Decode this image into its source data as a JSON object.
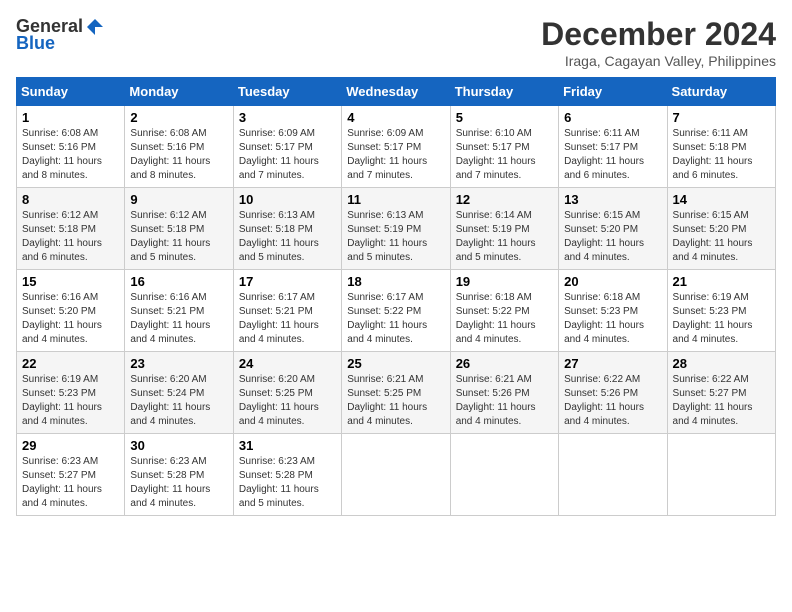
{
  "logo": {
    "general": "General",
    "blue": "Blue"
  },
  "title": "December 2024",
  "location": "Iraga, Cagayan Valley, Philippines",
  "days_header": [
    "Sunday",
    "Monday",
    "Tuesday",
    "Wednesday",
    "Thursday",
    "Friday",
    "Saturday"
  ],
  "weeks": [
    [
      {
        "day": "1",
        "sunrise": "6:08 AM",
        "sunset": "5:16 PM",
        "daylight": "11 hours and 8 minutes."
      },
      {
        "day": "2",
        "sunrise": "6:08 AM",
        "sunset": "5:16 PM",
        "daylight": "11 hours and 8 minutes."
      },
      {
        "day": "3",
        "sunrise": "6:09 AM",
        "sunset": "5:17 PM",
        "daylight": "11 hours and 7 minutes."
      },
      {
        "day": "4",
        "sunrise": "6:09 AM",
        "sunset": "5:17 PM",
        "daylight": "11 hours and 7 minutes."
      },
      {
        "day": "5",
        "sunrise": "6:10 AM",
        "sunset": "5:17 PM",
        "daylight": "11 hours and 7 minutes."
      },
      {
        "day": "6",
        "sunrise": "6:11 AM",
        "sunset": "5:17 PM",
        "daylight": "11 hours and 6 minutes."
      },
      {
        "day": "7",
        "sunrise": "6:11 AM",
        "sunset": "5:18 PM",
        "daylight": "11 hours and 6 minutes."
      }
    ],
    [
      {
        "day": "8",
        "sunrise": "6:12 AM",
        "sunset": "5:18 PM",
        "daylight": "11 hours and 6 minutes."
      },
      {
        "day": "9",
        "sunrise": "6:12 AM",
        "sunset": "5:18 PM",
        "daylight": "11 hours and 5 minutes."
      },
      {
        "day": "10",
        "sunrise": "6:13 AM",
        "sunset": "5:18 PM",
        "daylight": "11 hours and 5 minutes."
      },
      {
        "day": "11",
        "sunrise": "6:13 AM",
        "sunset": "5:19 PM",
        "daylight": "11 hours and 5 minutes."
      },
      {
        "day": "12",
        "sunrise": "6:14 AM",
        "sunset": "5:19 PM",
        "daylight": "11 hours and 5 minutes."
      },
      {
        "day": "13",
        "sunrise": "6:15 AM",
        "sunset": "5:20 PM",
        "daylight": "11 hours and 4 minutes."
      },
      {
        "day": "14",
        "sunrise": "6:15 AM",
        "sunset": "5:20 PM",
        "daylight": "11 hours and 4 minutes."
      }
    ],
    [
      {
        "day": "15",
        "sunrise": "6:16 AM",
        "sunset": "5:20 PM",
        "daylight": "11 hours and 4 minutes."
      },
      {
        "day": "16",
        "sunrise": "6:16 AM",
        "sunset": "5:21 PM",
        "daylight": "11 hours and 4 minutes."
      },
      {
        "day": "17",
        "sunrise": "6:17 AM",
        "sunset": "5:21 PM",
        "daylight": "11 hours and 4 minutes."
      },
      {
        "day": "18",
        "sunrise": "6:17 AM",
        "sunset": "5:22 PM",
        "daylight": "11 hours and 4 minutes."
      },
      {
        "day": "19",
        "sunrise": "6:18 AM",
        "sunset": "5:22 PM",
        "daylight": "11 hours and 4 minutes."
      },
      {
        "day": "20",
        "sunrise": "6:18 AM",
        "sunset": "5:23 PM",
        "daylight": "11 hours and 4 minutes."
      },
      {
        "day": "21",
        "sunrise": "6:19 AM",
        "sunset": "5:23 PM",
        "daylight": "11 hours and 4 minutes."
      }
    ],
    [
      {
        "day": "22",
        "sunrise": "6:19 AM",
        "sunset": "5:23 PM",
        "daylight": "11 hours and 4 minutes."
      },
      {
        "day": "23",
        "sunrise": "6:20 AM",
        "sunset": "5:24 PM",
        "daylight": "11 hours and 4 minutes."
      },
      {
        "day": "24",
        "sunrise": "6:20 AM",
        "sunset": "5:25 PM",
        "daylight": "11 hours and 4 minutes."
      },
      {
        "day": "25",
        "sunrise": "6:21 AM",
        "sunset": "5:25 PM",
        "daylight": "11 hours and 4 minutes."
      },
      {
        "day": "26",
        "sunrise": "6:21 AM",
        "sunset": "5:26 PM",
        "daylight": "11 hours and 4 minutes."
      },
      {
        "day": "27",
        "sunrise": "6:22 AM",
        "sunset": "5:26 PM",
        "daylight": "11 hours and 4 minutes."
      },
      {
        "day": "28",
        "sunrise": "6:22 AM",
        "sunset": "5:27 PM",
        "daylight": "11 hours and 4 minutes."
      }
    ],
    [
      {
        "day": "29",
        "sunrise": "6:23 AM",
        "sunset": "5:27 PM",
        "daylight": "11 hours and 4 minutes."
      },
      {
        "day": "30",
        "sunrise": "6:23 AM",
        "sunset": "5:28 PM",
        "daylight": "11 hours and 4 minutes."
      },
      {
        "day": "31",
        "sunrise": "6:23 AM",
        "sunset": "5:28 PM",
        "daylight": "11 hours and 5 minutes."
      },
      null,
      null,
      null,
      null
    ]
  ],
  "labels": {
    "sunrise": "Sunrise:",
    "sunset": "Sunset:",
    "daylight": "Daylight hours"
  }
}
